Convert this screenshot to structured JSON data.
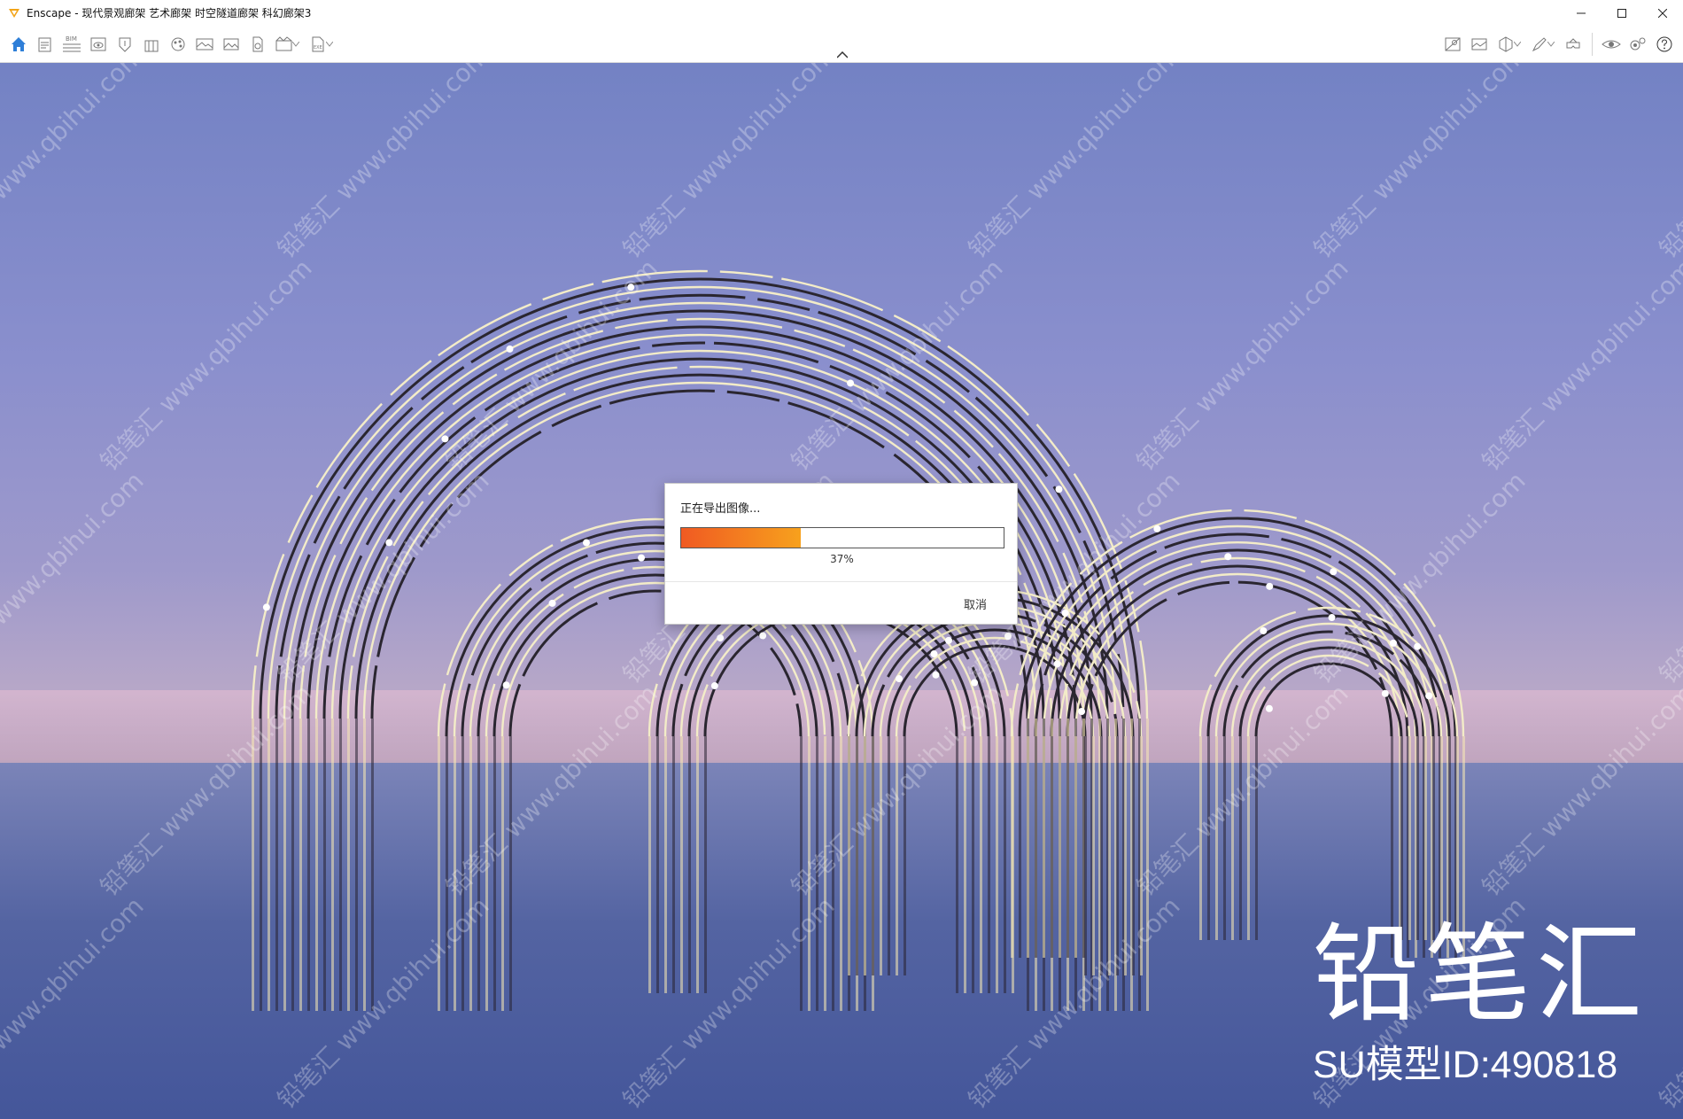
{
  "window": {
    "title": "Enscape - 现代景观廊架 艺术廊架 时空隧道廊架 科幻廊架3",
    "controls": [
      "minimize-icon",
      "maximize-icon",
      "close-icon"
    ]
  },
  "toolbar": {
    "left_icons": [
      "home-icon",
      "document-icon",
      "bim-icon",
      "view-icon",
      "asset-icon",
      "building-icon",
      "material-icon",
      "panorama-icon",
      "image-icon",
      "export-icon",
      "video-icon",
      "file-export-icon"
    ],
    "right_icons": [
      "map-icon",
      "image-gallery-icon",
      "cube-icon",
      "pen-icon",
      "vr-icon",
      "eye-icon",
      "settings-icon",
      "help-icon"
    ],
    "collapse_icon": "chevron-up-icon",
    "bim_label": "BIM",
    "exe_label": "EXE"
  },
  "colors": {
    "home_accent": "#2f7fd8",
    "progress_start": "#f05a22",
    "progress_end": "#f7a11d"
  },
  "dialog": {
    "title": "正在导出图像...",
    "progress": 0.37,
    "progress_text": "37%",
    "cancel_label": "取消"
  },
  "overlay": {
    "brand_name": "铅笔汇",
    "model_id": "SU模型ID:490818",
    "watermark_site": "www.qbihui.com",
    "watermark_name": "铅笔汇"
  }
}
